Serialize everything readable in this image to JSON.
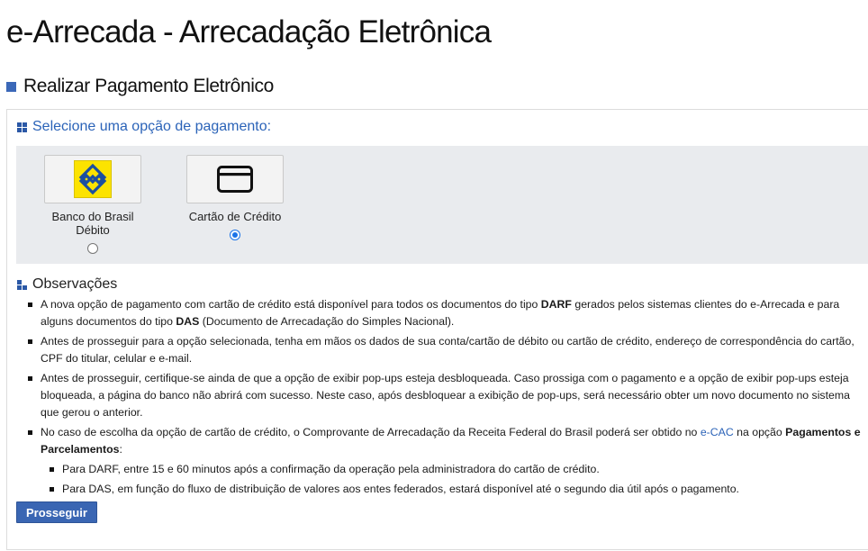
{
  "header": {
    "title": "e-Arrecada - Arrecadação Eletrônica"
  },
  "section": {
    "title": "Realizar Pagamento Eletrônico"
  },
  "payment": {
    "select_label": "Selecione uma opção de pagamento:",
    "options": [
      {
        "label_line1": "Banco do Brasil",
        "label_line2": "Débito",
        "selected": false,
        "icon": "banco-do-brasil-logo"
      },
      {
        "label_line1": "Cartão de Crédito",
        "label_line2": "",
        "selected": true,
        "icon": "credit-card-icon"
      }
    ]
  },
  "observations": {
    "title": "Observações",
    "items": [
      {
        "t1": "A nova opção de pagamento com cartão de crédito está disponível para todos os documentos do tipo ",
        "b1": "DARF",
        "t2": " gerados pelos sistemas clientes do e-Arrecada e para alguns documentos do tipo ",
        "b2": "DAS",
        "t3": " (Documento de Arrecadação do Simples Nacional)."
      },
      {
        "text": "Antes de prosseguir para a opção selecionada, tenha em mãos os dados de sua conta/cartão de débito ou cartão de crédito, endereço de correspondência do cartão, CPF do titular, celular e e-mail."
      },
      {
        "text": "Antes de prosseguir, certifique-se ainda de que a opção de exibir pop-ups esteja desbloqueada. Caso prossiga com o pagamento e a opção de exibir pop-ups esteja bloqueada, a página do banco não abrirá com sucesso. Neste caso, após desbloquear a exibição de pop-ups, será necessário obter um novo documento no sistema que gerou o anterior."
      },
      {
        "t1": "No caso de escolha da opção de cartão de crédito, o Comprovante de Arrecadação da Receita Federal do Brasil poderá ser obtido no ",
        "link": "e-CAC",
        "t2": " na opção ",
        "b1": "Pagamentos e Parcelamentos",
        "t3": ":",
        "sub": [
          "Para DARF, entre 15 e 60 minutos após a confirmação da operação pela administradora do cartão de crédito.",
          "Para DAS, em função do fluxo de distribuição de valores aos entes federados, estará disponível até o segundo dia útil após o pagamento."
        ]
      }
    ]
  },
  "actions": {
    "proceed_label": "Prosseguir"
  },
  "colors": {
    "accent": "#3a66b3",
    "link": "#2b63b8",
    "options_bg": "#e9ebee",
    "bb_yellow": "#fce300",
    "bb_blue": "#1c4fa0"
  }
}
